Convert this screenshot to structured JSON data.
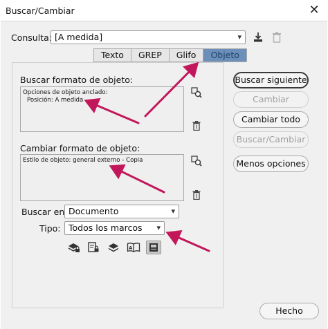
{
  "window": {
    "title": "Buscar/Cambiar",
    "close_glyph": "✕"
  },
  "query": {
    "label": "Consulta:",
    "value": "[A medida]"
  },
  "tabs": [
    {
      "label": "Texto",
      "active": false
    },
    {
      "label": "GREP",
      "active": false
    },
    {
      "label": "Glifo",
      "active": false
    },
    {
      "label": "Objeto",
      "active": true
    }
  ],
  "find_format": {
    "label": "Buscar formato de objeto:",
    "lines": [
      "Opciones de objeto anclado:",
      "  Posición: A medida"
    ]
  },
  "change_format": {
    "label": "Cambiar formato de objeto:",
    "lines": [
      "Estilo de objeto: general externo - Copia"
    ]
  },
  "search_in": {
    "label": "Buscar en:",
    "value": "Documento"
  },
  "type": {
    "label": "Tipo:",
    "value": "Todos los marcos"
  },
  "buttons": {
    "find_next": "Buscar siguiente",
    "change": "Cambiar",
    "change_all": "Cambiar todo",
    "find_change": "Buscar/Cambiar",
    "fewer_options": "Menos opciones",
    "done": "Hecho"
  },
  "colors": {
    "active_tab": "#6b8fb9",
    "annotation_arrow": "#c2185b"
  }
}
